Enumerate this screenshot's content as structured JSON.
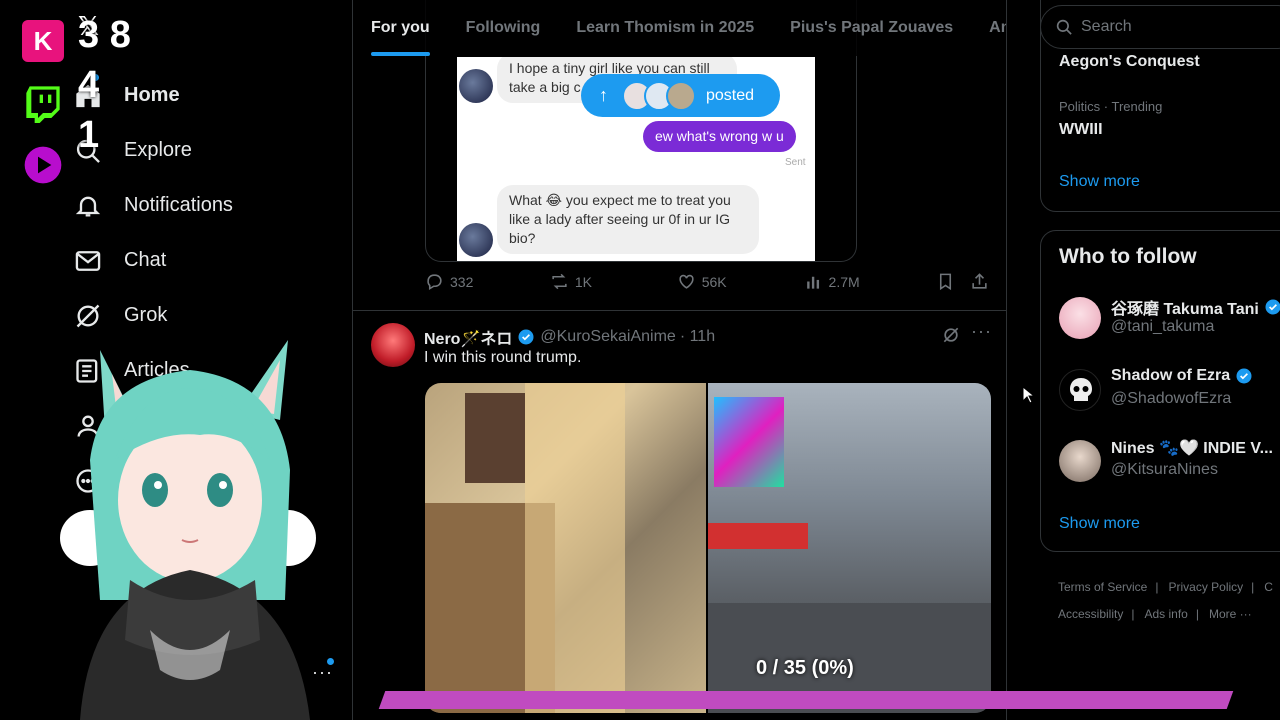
{
  "overlay": {
    "counts": [
      "3 8",
      "4",
      "1"
    ]
  },
  "nav": {
    "logo": "𝕏",
    "items": [
      {
        "label": "Home",
        "icon": "home-icon"
      },
      {
        "label": "Explore",
        "icon": "search-icon"
      },
      {
        "label": "Notifications",
        "icon": "bell-icon"
      },
      {
        "label": "Chat",
        "icon": "envelope-icon"
      },
      {
        "label": "Grok",
        "icon": "grok-icon"
      },
      {
        "label": "Articles",
        "icon": "article-icon"
      }
    ],
    "more": "···"
  },
  "tabs": [
    "For you",
    "Following",
    "Learn Thomism in 2025",
    "Pius's Papal Zouaves",
    "Am"
  ],
  "post1": {
    "chat": {
      "msg1": "I hope a tiny girl like you can still take a big c",
      "msg2": "ew what's wrong w u",
      "sent": "Sent",
      "msg3": "What 😂 you expect me to treat you like a lady after seeing ur 0f in ur IG bio?"
    },
    "posted_pill": "posted",
    "stats": {
      "replies": "332",
      "reposts": "1K",
      "likes": "56K",
      "views": "2.7M"
    }
  },
  "post2": {
    "name": "Nero🪄ネロ",
    "handle": "@KuroSekaiAnime",
    "time": "· 11h",
    "text": "I win this round trump."
  },
  "progress": {
    "label": "0 / 35 (0%)",
    "value": 0.0
  },
  "sidebar": {
    "search_placeholder": "Search",
    "trend1": "Aegon's Conquest",
    "trend2_meta": "Politics · Trending",
    "trend2": "WWIII",
    "show_more": "Show more",
    "follow_heading": "Who to follow",
    "follows": [
      {
        "name": "谷琢磨 Takuma Tani",
        "handle": "@tani_takuma"
      },
      {
        "name": "Shadow of Ezra",
        "handle": "@ShadowofEzra"
      },
      {
        "name": "Nines 🐾🤍 INDIE V...",
        "handle": "@KitsuraNines"
      }
    ],
    "footer": [
      "Terms of Service",
      "Privacy Policy",
      "C",
      "Accessibility",
      "Ads info",
      "More ···"
    ]
  },
  "colors": {
    "accent": "#1d9bf0",
    "progress": "#c04bc0",
    "background": "#000000"
  }
}
